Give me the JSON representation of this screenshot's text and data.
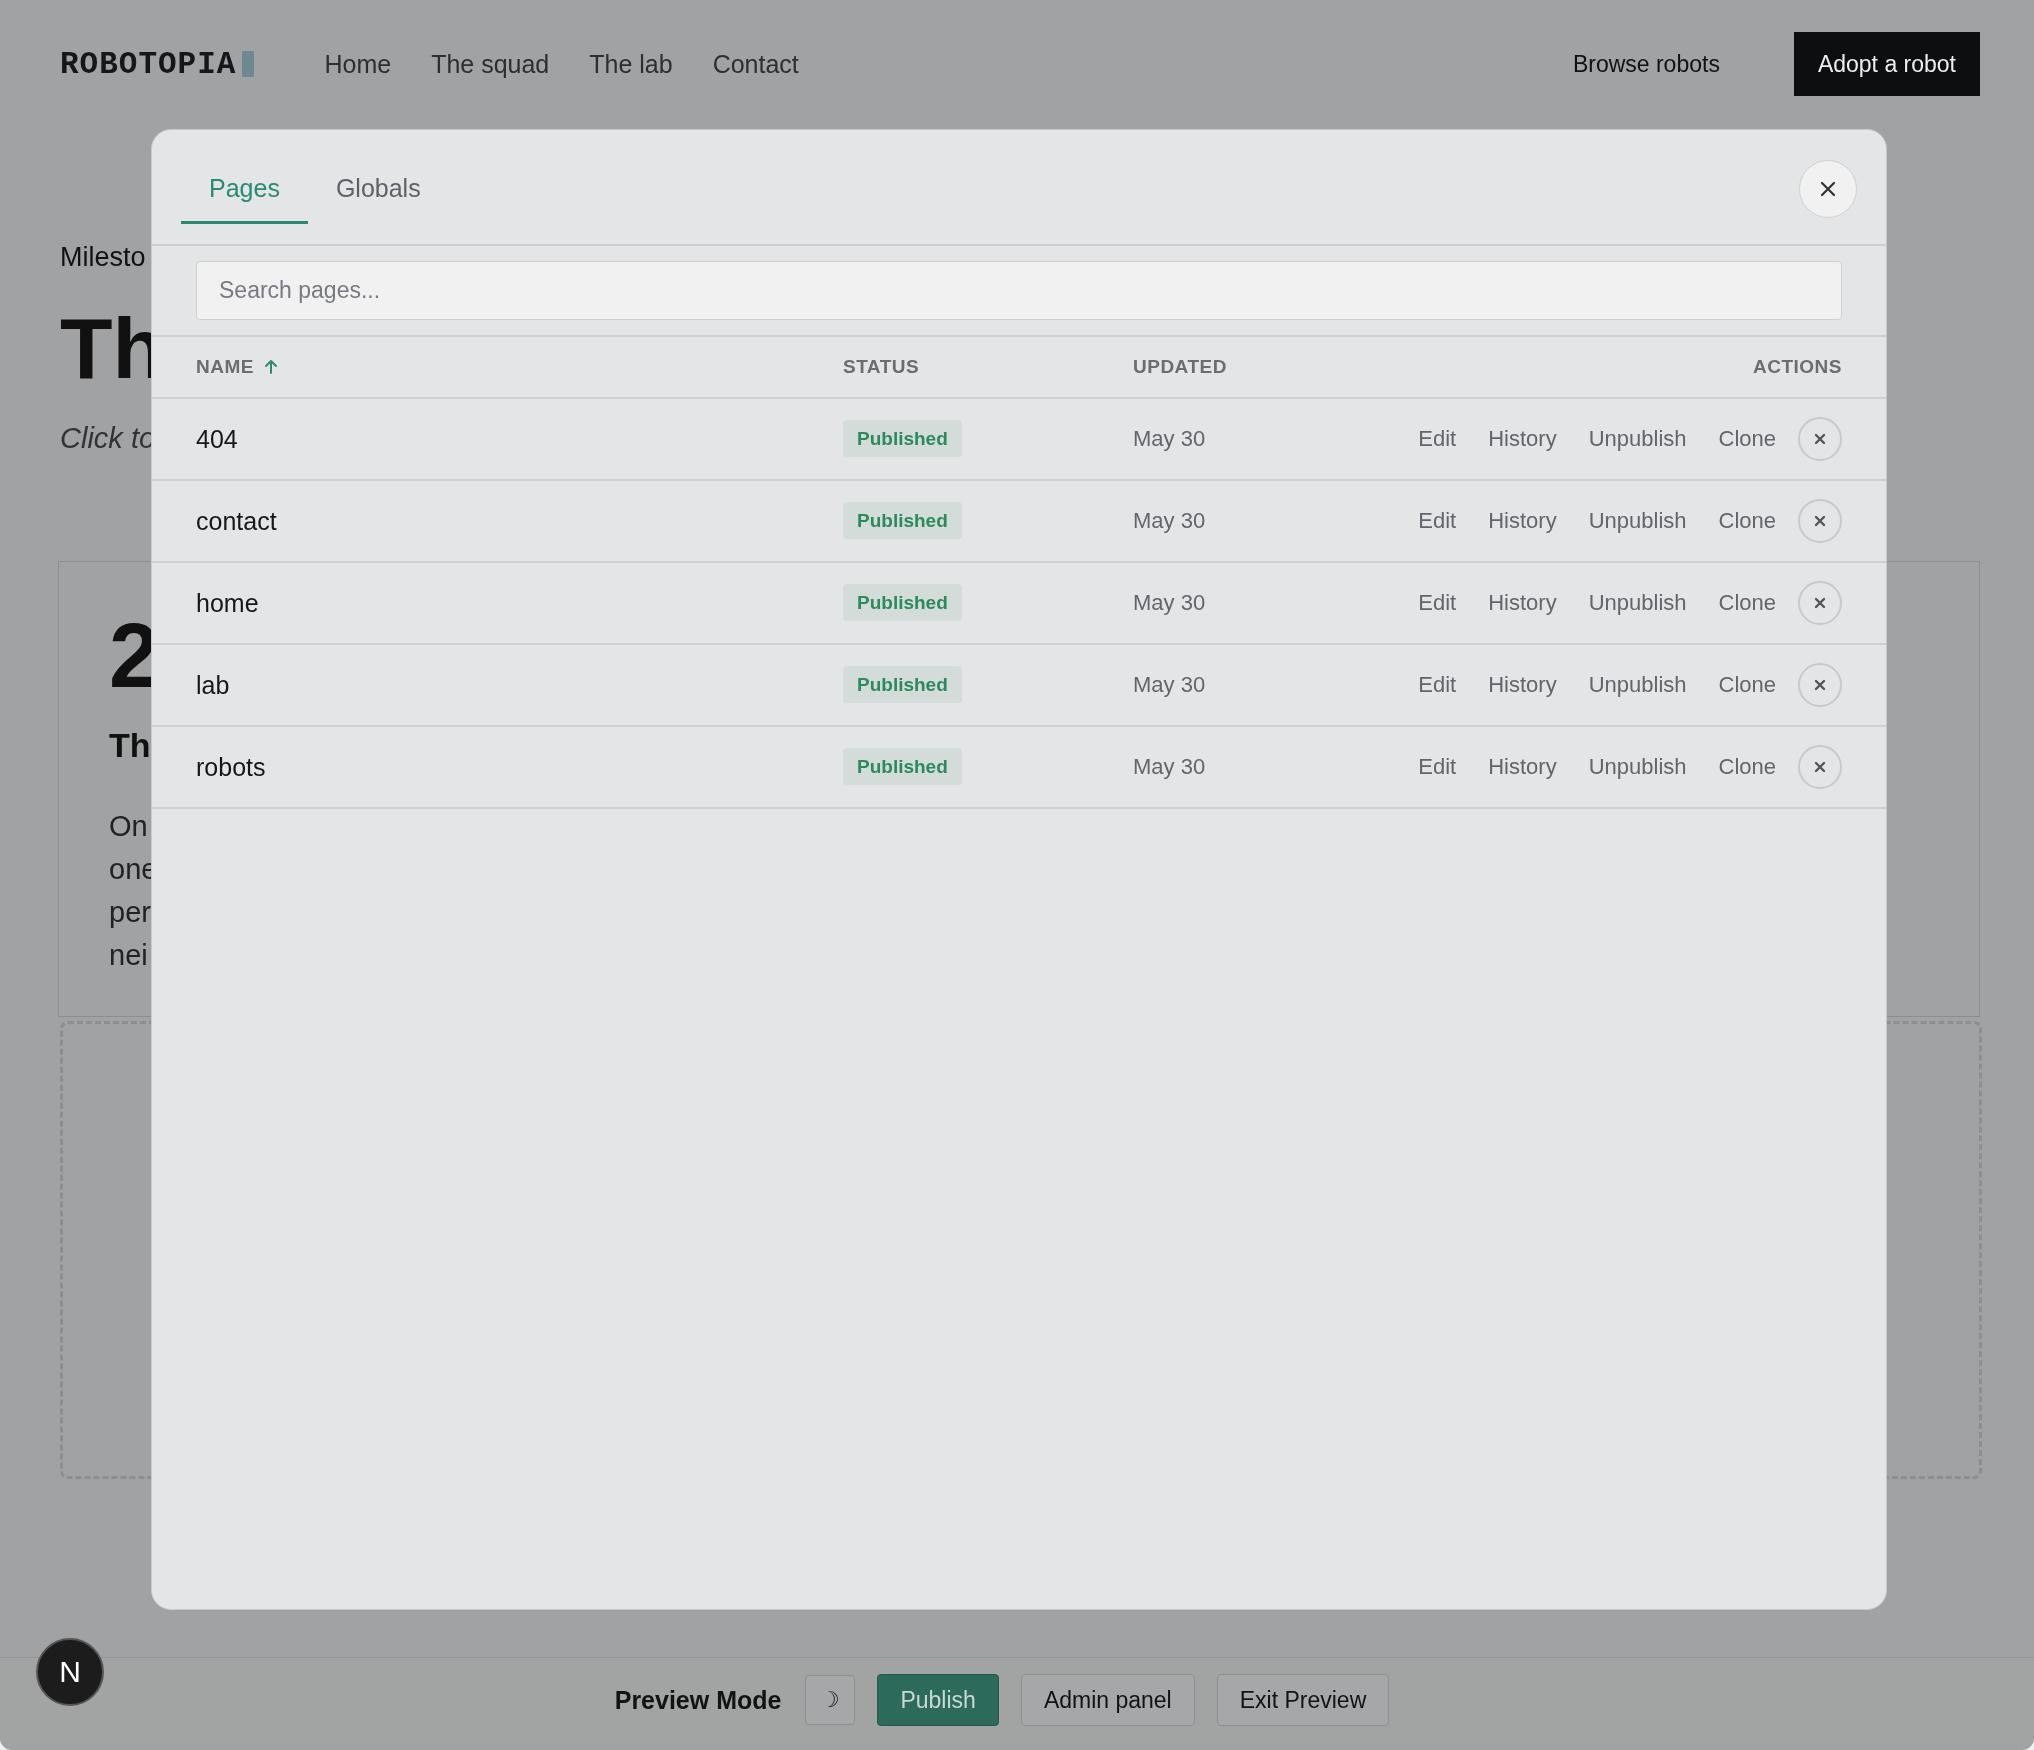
{
  "site_header": {
    "logo": "ROBOTOPIA",
    "nav": [
      "Home",
      "The squad",
      "The lab",
      "Contact"
    ],
    "browse_link": "Browse robots",
    "cta_button": "Adopt a robot"
  },
  "background_page": {
    "eyebrow": "Milesto",
    "heading": "Th",
    "hint": "Click to",
    "card": {
      "number": "2",
      "title": "Th",
      "lines": [
        "On",
        "one",
        "per",
        "nei"
      ]
    }
  },
  "modal": {
    "tabs": [
      {
        "label": "Pages",
        "selected": true
      },
      {
        "label": "Globals",
        "selected": false
      }
    ],
    "search": {
      "placeholder": "Search pages..."
    },
    "columns": [
      {
        "label": "NAME",
        "sorted": true
      },
      {
        "label": "STATUS",
        "sorted": false
      },
      {
        "label": "UPDATED",
        "sorted": false
      },
      {
        "label": "ACTIONS",
        "sorted": false
      }
    ],
    "rows": [
      {
        "name": "404",
        "status": "Published",
        "updated": "May 30",
        "actions": [
          "Edit",
          "History",
          "Unpublish",
          "Clone"
        ]
      },
      {
        "name": "contact",
        "status": "Published",
        "updated": "May 30",
        "actions": [
          "Edit",
          "History",
          "Unpublish",
          "Clone"
        ]
      },
      {
        "name": "home",
        "status": "Published",
        "updated": "May 30",
        "actions": [
          "Edit",
          "History",
          "Unpublish",
          "Clone"
        ]
      },
      {
        "name": "lab",
        "status": "Published",
        "updated": "May 30",
        "actions": [
          "Edit",
          "History",
          "Unpublish",
          "Clone"
        ]
      },
      {
        "name": "robots",
        "status": "Published",
        "updated": "May 30",
        "actions": [
          "Edit",
          "History",
          "Unpublish",
          "Clone"
        ]
      }
    ]
  },
  "preview_bar": {
    "label": "Preview Mode",
    "theme_toggle": "☽",
    "buttons": [
      {
        "label": "Publish",
        "kind": "primary"
      },
      {
        "label": "Admin panel",
        "kind": "secondary"
      },
      {
        "label": "Exit Preview",
        "kind": "secondary"
      }
    ]
  },
  "dev_badge": "N"
}
